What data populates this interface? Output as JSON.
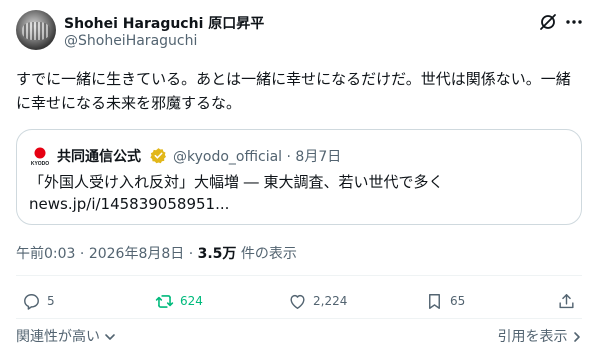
{
  "author": {
    "display_name": "Shohei Haraguchi 原口昇平",
    "handle": "@ShoheiHaraguchi"
  },
  "tweet": {
    "text": "すでに一緒に生きている。あとは一緒に幸せになるだけだ。世代は関係ない。一緒に幸せになる未来を邪魔するな。",
    "time": "午前0:03",
    "date": "2026年8月8日",
    "views_count": "3.5万",
    "views_label": "件の表示"
  },
  "quote": {
    "logo_text": "KYODO",
    "name": "共同通信公式",
    "handle_date": "@kyodo_official · 8月7日",
    "text": "「外国人受け入れ反対」大幅増 ― 東大調査、若い世代で多く",
    "link": "news.jp/i/145839058951..."
  },
  "actions": {
    "replies": "5",
    "retweets": "624",
    "likes": "2,224",
    "bookmarks": "65"
  },
  "footer": {
    "sort_label": "関連性が高い",
    "quotes_label": "引用を表示"
  },
  "colors": {
    "text": "#0f1419",
    "secondary": "#536471",
    "retweet_green": "#00ba7c",
    "verified_gold": "#e2b719",
    "kyodo_red": "#e60012"
  }
}
